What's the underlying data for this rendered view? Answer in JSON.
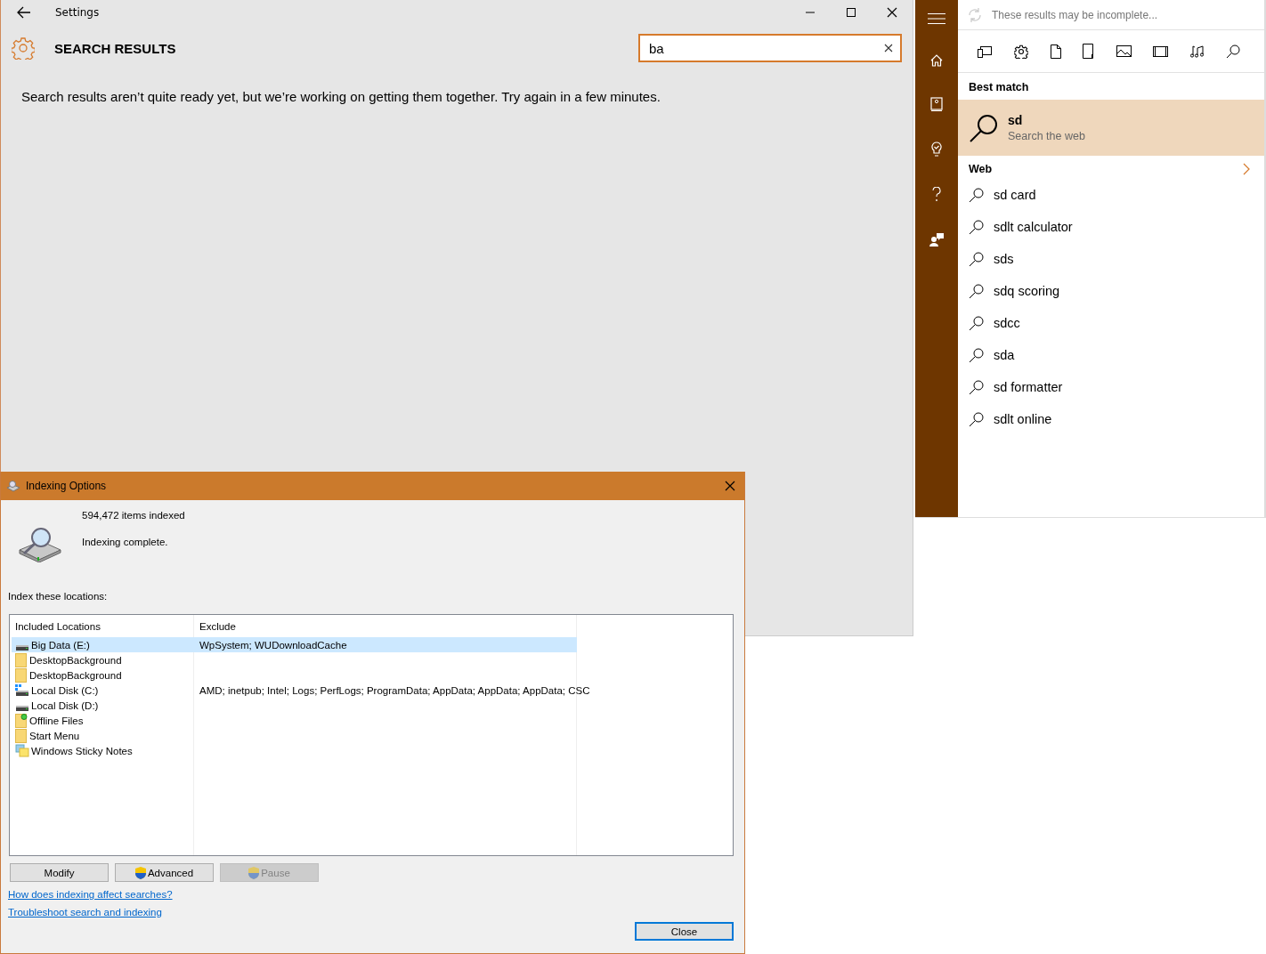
{
  "settings": {
    "title": "Settings",
    "heading": "SEARCH RESULTS",
    "search": {
      "value": "ba"
    },
    "message": "Search results aren’t quite ready yet, but we’re working on getting them together. Try again in a few minutes."
  },
  "search_panel": {
    "status": "These results may be incomplete...",
    "best_match": {
      "heading": "Best match",
      "title": "sd",
      "subtitle": "Search the web",
      "selected": true
    },
    "web": {
      "heading": "Web",
      "suggestions": [
        "sd card",
        "sdlt calculator",
        "sds",
        "sdq scoring",
        "sdcc",
        "sda",
        "sd formatter",
        "sdlt online"
      ]
    }
  },
  "indexing_options": {
    "title": "Indexing Options",
    "count": "594,472 items indexed",
    "status": "Indexing complete.",
    "prompt": "Index these locations:",
    "columns": [
      "Included Locations",
      "Exclude"
    ],
    "rows": [
      {
        "kind": "drive",
        "location": "Big Data (E:)",
        "exclude": "WpSystem; WUDownloadCache",
        "selected": true
      },
      {
        "kind": "folder",
        "location": "DesktopBackground",
        "exclude": "",
        "selected": false
      },
      {
        "kind": "folder",
        "location": "DesktopBackground",
        "exclude": "",
        "selected": false
      },
      {
        "kind": "system-drive",
        "location": "Local Disk (C:)",
        "exclude": "AMD; inetpub; Intel; Logs; PerfLogs; ProgramData; AppData; AppData; AppData; CSC",
        "selected": false
      },
      {
        "kind": "drive",
        "location": "Local Disk (D:)",
        "exclude": "",
        "selected": false
      },
      {
        "kind": "offline-folder",
        "location": "Offline Files",
        "exclude": "",
        "selected": false
      },
      {
        "kind": "folder",
        "location": "Start Menu",
        "exclude": "",
        "selected": false
      },
      {
        "kind": "notes",
        "location": "Windows Sticky Notes",
        "exclude": "",
        "selected": false
      }
    ],
    "buttons": [
      {
        "label": "Modify",
        "shield": false,
        "disabled": false
      },
      {
        "label": "Advanced",
        "shield": true,
        "disabled": false
      },
      {
        "label": "Pause",
        "shield": true,
        "disabled": true
      }
    ],
    "links": [
      "How does indexing affect searches?",
      "Troubleshoot search and indexing"
    ],
    "close_button": "Close"
  }
}
